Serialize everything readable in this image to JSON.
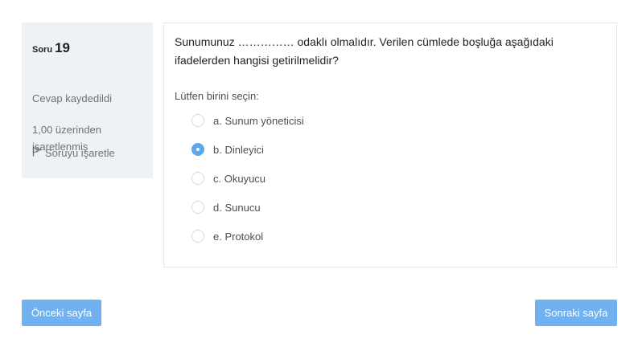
{
  "info": {
    "question_label": "Soru",
    "question_number": "19",
    "state": "Cevap kaydedildi",
    "grade": "1,00 üzerinden işaretlenmiş",
    "flag_label": "Soruyu işaretle"
  },
  "question": {
    "text": "Sunumunuz …………… odaklı olmalıdır. Verilen cümlede boşluğa aşağıdaki ifadelerden hangisi getirilmelidir?",
    "prompt": "Lütfen birini seçin:",
    "options": [
      {
        "label": "a. Sunum yöneticisi",
        "selected": false
      },
      {
        "label": "b. Dinleyici",
        "selected": true
      },
      {
        "label": "c. Okuyucu",
        "selected": false
      },
      {
        "label": "d. Sunucu",
        "selected": false
      },
      {
        "label": "e. Protokol",
        "selected": false
      }
    ]
  },
  "nav": {
    "prev_label": "Önceki sayfa",
    "next_label": "Sonraki sayfa"
  },
  "colors": {
    "accent": "#71b1ef",
    "info_bg": "#eef2f4"
  }
}
